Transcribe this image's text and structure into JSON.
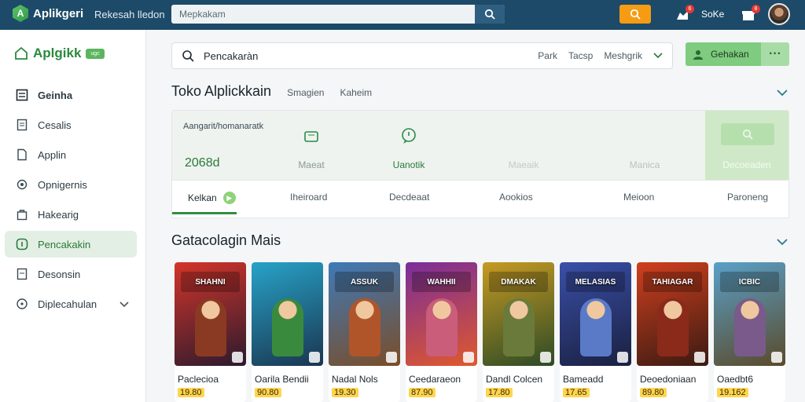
{
  "topbar": {
    "app_name": "Aplikgeri",
    "subtitle": "Rekesah lledon",
    "search_value": "Mepkakam",
    "user": "SoKe",
    "notif_count_1": "6",
    "notif_count_2": "8"
  },
  "sidebar": {
    "brand": "Aplgikk",
    "brand_tag": "ugc",
    "items": [
      {
        "label": "Geinha",
        "icon": "ledger-icon"
      },
      {
        "label": "Cesalis",
        "icon": "receipt-icon"
      },
      {
        "label": "Applin",
        "icon": "document-icon"
      },
      {
        "label": "Opnigernis",
        "icon": "settings-icon"
      },
      {
        "label": "Hakearig",
        "icon": "bag-icon"
      },
      {
        "label": "Pencakakin",
        "icon": "help-icon"
      },
      {
        "label": "Desonsin",
        "icon": "list-icon"
      },
      {
        "label": "Diplecahulan",
        "icon": "circle-icon"
      }
    ]
  },
  "search": {
    "value": "Pencakaràn",
    "filters": [
      "Park",
      "Tacsp",
      "Meshgrik"
    ],
    "action_label": "Gehakan"
  },
  "store": {
    "title": "Toko Alplickkain",
    "sub1": "Smagien",
    "sub2": "Kaheim"
  },
  "stats": {
    "label": "Aangarit/homanaratk",
    "value": "2068d",
    "cols": [
      "Maeat",
      "Uanotik",
      "Maeaik",
      "Manica"
    ],
    "cta_label": "Decoeaden"
  },
  "tabs": [
    "Kelkan",
    "Iheiroard",
    "Decdeaat",
    "Aookios",
    "Meioon",
    "Paroneng"
  ],
  "games_title": "Gatacolagin Mais",
  "games": [
    {
      "name": "Paclecioa",
      "price": "19.80",
      "art_title": "SHAHNI",
      "c1": "#d4352a",
      "c2": "#2b1a2e",
      "hero": "#8a3a22"
    },
    {
      "name": "Oarila Bendii",
      "price": "90.80",
      "art_title": "",
      "c1": "#27a3c8",
      "c2": "#1a3550",
      "hero": "#3a8a3e"
    },
    {
      "name": "Nadal Nols",
      "price": "19.30",
      "art_title": "ASSUK",
      "c1": "#3f7ab8",
      "c2": "#7a4d28",
      "hero": "#b0552a"
    },
    {
      "name": "Ceedaraeon",
      "price": "87.90",
      "art_title": "WAHHII",
      "c1": "#7a2d9a",
      "c2": "#e0592b",
      "hero": "#c95d7a"
    },
    {
      "name": "Dandl Colcen",
      "price": "17.80",
      "art_title": "DMAKAK",
      "c1": "#c79a22",
      "c2": "#2c4a26",
      "hero": "#6a7a3a"
    },
    {
      "name": "Bameadd",
      "price": "17.65",
      "art_title": "MELASIAS",
      "c1": "#3a4fa8",
      "c2": "#1a2040",
      "hero": "#5a7ac8"
    },
    {
      "name": "Deoedoniaan",
      "price": "89.80",
      "art_title": "TAHIAGAR",
      "c1": "#d0401e",
      "c2": "#3a1a12",
      "hero": "#8a2a1a"
    },
    {
      "name": "Oaedbt6",
      "price": "19.162",
      "art_title": "ICBIC",
      "c1": "#5aa0c8",
      "c2": "#5a4a2a",
      "hero": "#7a5a8a"
    }
  ]
}
